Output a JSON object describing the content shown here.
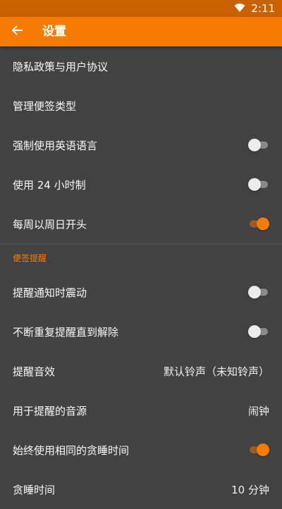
{
  "status_bar": {
    "time": "2:11",
    "icons": [
      "wifi-icon",
      "battery-icon"
    ]
  },
  "app_bar": {
    "title": "设置",
    "back_icon": "arrow-back-icon"
  },
  "colors": {
    "accent": "#f57c00",
    "status_bar": "#ca6100",
    "background": "#424242"
  },
  "settings": {
    "privacy": "隐私政策与用户协议",
    "manage_types": "管理便签类型",
    "force_english": {
      "label": "强制使用英语语言",
      "enabled": false
    },
    "use_24h": {
      "label": "使用 24 小时制",
      "enabled": false
    },
    "week_starts_sunday": {
      "label": "每周以周日开头",
      "enabled": true
    }
  },
  "reminder_section": {
    "header": "便签提醒",
    "vibrate": {
      "label": "提醒通知时震动",
      "enabled": false
    },
    "repeat_until_dismissed": {
      "label": "不断重复提醒直到解除",
      "enabled": false
    },
    "sound": {
      "label": "提醒音效",
      "value": "默认铃声（未知铃声）"
    },
    "audio_source": {
      "label": "用于提醒的音源",
      "value": "闹钟"
    },
    "same_snooze": {
      "label": "始终使用相同的贪睡时间",
      "enabled": true
    },
    "snooze_time": {
      "label": "贪睡时间",
      "value": "10 分钟"
    }
  }
}
